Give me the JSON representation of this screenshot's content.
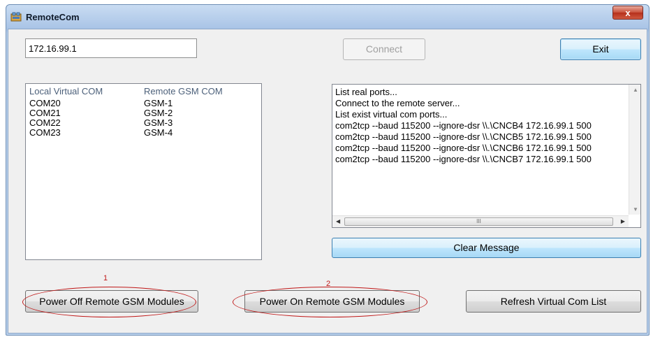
{
  "window": {
    "title": "RemoteCom",
    "close_glyph": "x"
  },
  "ip_input": {
    "value": "172.16.99.1"
  },
  "buttons": {
    "connect": "Connect",
    "exit": "Exit",
    "clear_message": "Clear Message",
    "power_off": "Power Off Remote GSM Modules",
    "power_on": "Power On Remote GSM Modules",
    "refresh": "Refresh Virtual Com List"
  },
  "com_list": {
    "columns": [
      "Local Virtual COM",
      "Remote GSM COM"
    ],
    "rows": [
      [
        "COM20",
        "GSM-1"
      ],
      [
        "COM21",
        "GSM-2"
      ],
      [
        "COM22",
        "GSM-3"
      ],
      [
        "COM23",
        "GSM-4"
      ]
    ]
  },
  "log": {
    "lines": [
      "List real ports...",
      "Connect to the remote server...",
      "List exist virtual com ports...",
      "com2tcp --baud 115200 --ignore-dsr \\\\.\\CNCB4 172.16.99.1 500",
      "com2tcp --baud 115200 --ignore-dsr \\\\.\\CNCB5 172.16.99.1 500",
      "com2tcp --baud 115200 --ignore-dsr \\\\.\\CNCB6 172.16.99.1 500",
      "com2tcp --baud 115200 --ignore-dsr \\\\.\\CNCB7 172.16.99.1 500"
    ],
    "scroll_thumb_glyph": "III",
    "icons": {
      "scroll_left": "scroll-left-arrow-icon",
      "scroll_right": "scroll-right-arrow-icon",
      "scroll_up": "scroll-up-arrow-icon",
      "scroll_down": "scroll-down-arrow-icon"
    }
  },
  "annotations": {
    "marker_1": "1",
    "marker_2": "2",
    "color": "#c01818"
  }
}
